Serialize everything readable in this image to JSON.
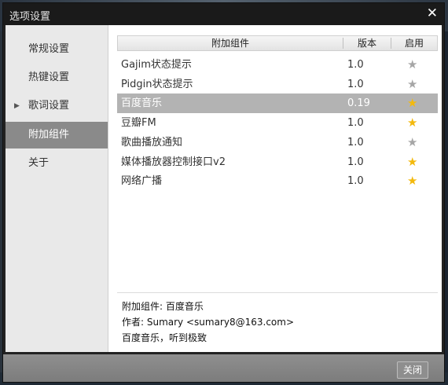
{
  "dialog": {
    "title": "选项设置",
    "close_glyph": "✕"
  },
  "sidebar": {
    "items": [
      {
        "label": "常规设置",
        "expandable": false,
        "active": false
      },
      {
        "label": "热键设置",
        "expandable": false,
        "active": false
      },
      {
        "label": "歌词设置",
        "expandable": true,
        "active": false
      },
      {
        "label": "附加组件",
        "expandable": false,
        "active": true
      },
      {
        "label": "关于",
        "expandable": false,
        "active": false
      }
    ],
    "expand_glyph": "▶"
  },
  "table": {
    "columns": [
      "附加组件",
      "版本",
      "启用"
    ],
    "rows": [
      {
        "name": "Gajim状态提示",
        "version": "1.0",
        "enabled": false,
        "selected": false
      },
      {
        "name": "Pidgin状态提示",
        "version": "1.0",
        "enabled": false,
        "selected": false
      },
      {
        "name": "百度音乐",
        "version": "0.19",
        "enabled": true,
        "selected": true
      },
      {
        "name": "豆瓣FM",
        "version": "1.0",
        "enabled": true,
        "selected": false
      },
      {
        "name": "歌曲播放通知",
        "version": "1.0",
        "enabled": false,
        "selected": false
      },
      {
        "name": "媒体播放器控制接口v2",
        "version": "1.0",
        "enabled": true,
        "selected": false
      },
      {
        "name": "网络广播",
        "version": "1.0",
        "enabled": true,
        "selected": false
      }
    ],
    "star_glyph": "★",
    "star_on_color": "#f3b90d",
    "star_off_color": "#a6a6a6"
  },
  "info": {
    "line1": "附加组件: 百度音乐",
    "line2": "作者: Sumary <sumary8@163.com>",
    "line3": "百度音乐，听到极致"
  },
  "footer": {
    "close_label": "关闭"
  },
  "colors": {
    "title_bar": "#1a1a1a",
    "selection": "#b3b3b3",
    "sidebar_active": "#8a8a8a"
  }
}
